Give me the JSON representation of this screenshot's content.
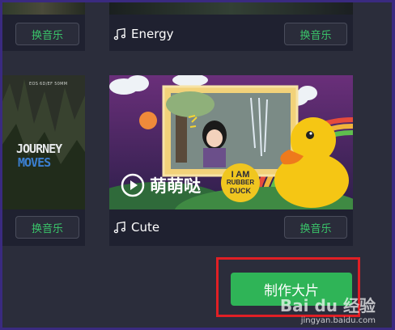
{
  "top_row": {
    "left_card": {
      "change_music_label": "换音乐"
    },
    "right_card": {
      "track_name": "Energy",
      "change_music_label": "换音乐"
    }
  },
  "bottom_row": {
    "left_card": {
      "thumb_caption_small": "EOS 6D/EF 50MM",
      "thumb_title_1": "JOURNEY",
      "thumb_title_2": "MOVES",
      "change_music_label": "换音乐"
    },
    "right_card": {
      "play_label": "萌萌哒",
      "duck_sign": [
        "I AM",
        "RUBBER",
        "DUCK"
      ],
      "track_name": "Cute",
      "change_music_label": "换音乐"
    }
  },
  "make_button_label": "制作大片",
  "watermark": {
    "brand": "Bai du 经验",
    "url": "jingyan.baidu.com"
  },
  "colors": {
    "accent": "#2fb457",
    "highlight": "#e01f25",
    "bg": "#2b2d3b"
  }
}
